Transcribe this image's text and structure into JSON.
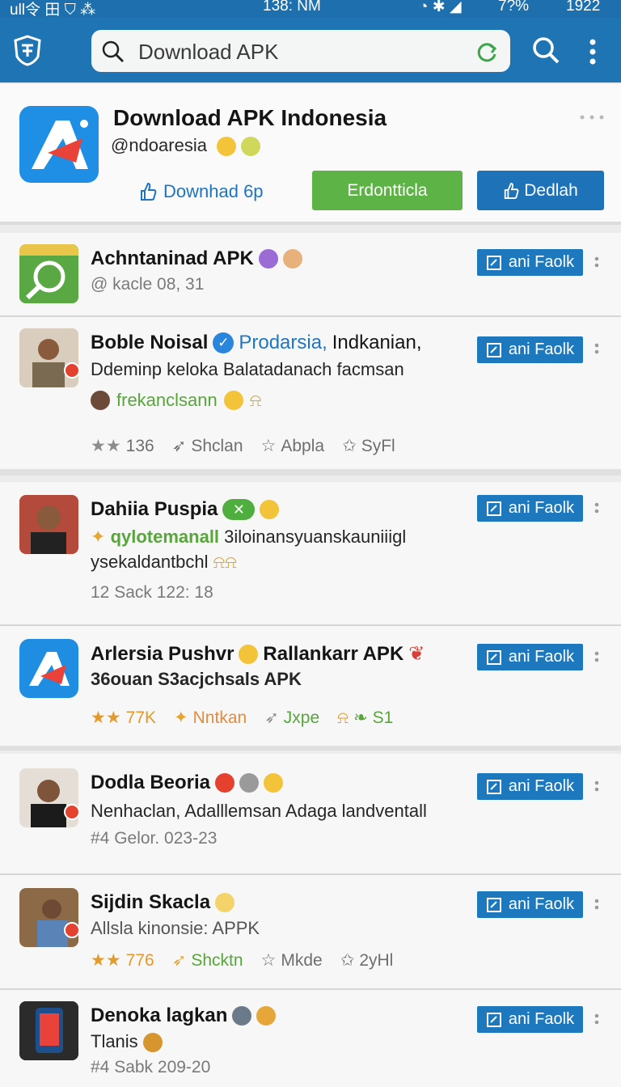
{
  "status_bar": {
    "left": "ull令 田  ⛉  ⁂",
    "time": "138: NM",
    "battery": "7?%",
    "clock_right": "1922"
  },
  "search": {
    "value": "Download APK"
  },
  "profile": {
    "name": "Download APK Indonesia",
    "handle": "@ndoaresia",
    "download_link": "Downhad 6p",
    "primary_button": "Erdontticla",
    "secondary_button": "Dedlah"
  },
  "follow_label": "ani Faolk",
  "posts": [
    {
      "name": "Achntaninad APK",
      "meta": "@ kacle 08, 31"
    },
    {
      "name": "Boble Noisal",
      "name_suffix": "Prodarsia,",
      "name_tail": "Indkanian,",
      "line1": "Ddeminp keloka Balatadanach facmsan",
      "line2": "frekanclsann",
      "actions": [
        "136",
        "Shclan",
        "Abpla",
        "SyFl"
      ]
    },
    {
      "name": "Dahiia Puspia",
      "line1_highlight": "qylotemanall",
      "line1_rest": "3iloinansyuanskauniiigl",
      "line2": "ysekaldantbchl",
      "meta": "12 Sack 122: 18"
    },
    {
      "name": "Arlersia Pushvr",
      "name_tail": "Rallankarr APK",
      "line1": "36ouan S3acjchsals APK",
      "actions": [
        "77K",
        "Nntkan",
        "Jxpe",
        "S1"
      ]
    },
    {
      "name": "Dodla Beoria",
      "line1": "Nenhaclan, Adalllemsan Adaga landventall",
      "meta": "#4 Gelor. 023-23"
    },
    {
      "name": "Sijdin Skacla",
      "line1": "Allsla kinonsie: APPK",
      "actions": [
        "776",
        "Shcktn",
        "Mkde",
        "2yHl"
      ]
    },
    {
      "name": "Denoka lagkan",
      "line1": "Tlanis",
      "meta": "#4 Sabk 209-20"
    }
  ]
}
